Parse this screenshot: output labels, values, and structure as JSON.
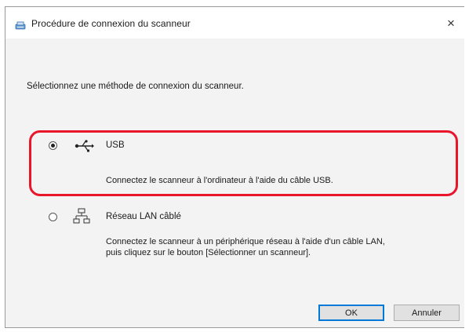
{
  "window": {
    "title": "Procédure de connexion du scanneur",
    "close_glyph": "×",
    "title_icon": "scanner-app-icon"
  },
  "instruction": "Sélectionnez une méthode de connexion du scanneur.",
  "options": [
    {
      "label": "USB",
      "description": "Connectez le scanneur à l'ordinateur à l'aide du câble USB.",
      "icon": "usb-icon",
      "selected": true,
      "highlighted": true
    },
    {
      "label": "Réseau LAN câblé",
      "description_line1": "Connectez le scanneur à un périphérique réseau à l'aide d'un câble LAN,",
      "description_line2": "puis cliquez sur le bouton [Sélectionner un scanneur].",
      "icon": "wired-lan-icon",
      "selected": false,
      "highlighted": false
    }
  ],
  "buttons": {
    "ok_label": "OK",
    "cancel_label": "Annuler"
  },
  "colors": {
    "highlight": "#e8152b",
    "content_bg": "#f3f3f3",
    "default_button_border": "#0078d7"
  }
}
